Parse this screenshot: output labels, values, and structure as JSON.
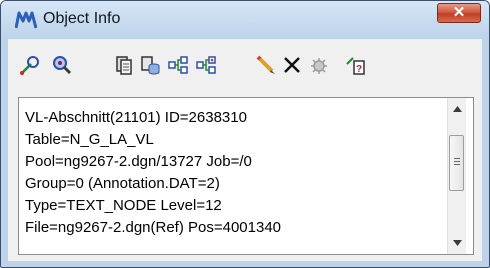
{
  "window": {
    "title": "Object Info",
    "close_label": "✕"
  },
  "toolbar": {
    "buttons": [
      "element-selection-tool-icon",
      "fit-view-tool-icon",
      "copy-tool-icon",
      "copy-database-tool-icon",
      "connect-tool-icon",
      "connect-multi-tool-icon",
      "pencil-tool-icon",
      "delete-icon",
      "settings-disabled-icon",
      "help-info-icon"
    ]
  },
  "info": {
    "lines": [
      "VL-Abschnitt(21101) ID=2638310",
      "Table=N_G_LA_VL",
      "Pool=ng9267-2.dgn/13727 Job=/0",
      "Group=0 (Annotation.DAT=2)",
      "Type=TEXT_NODE Level=12",
      "File=ng9267-2.dgn(Ref) Pos=4001340"
    ]
  },
  "colors": {
    "accent": "#bdd3ea",
    "close": "#c84a30"
  }
}
